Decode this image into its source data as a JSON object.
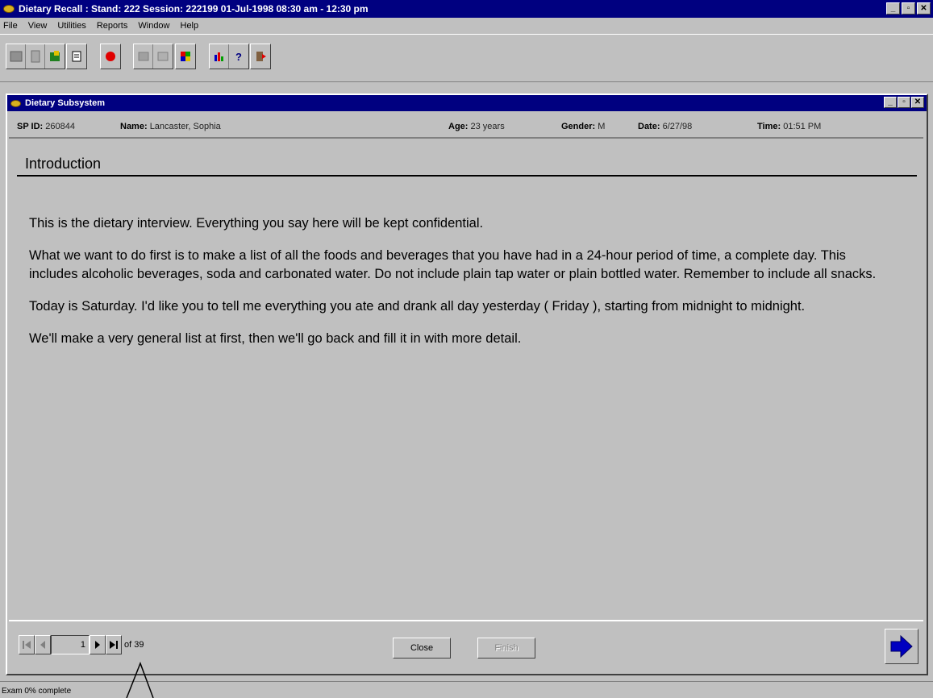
{
  "app": {
    "title": "Dietary Recall : Stand: 222 Session: 222199 01-Jul-1998 08:30 am - 12:30 pm",
    "window_controls": [
      "_",
      "▫",
      "✕"
    ]
  },
  "menu": {
    "items": [
      {
        "label": "File"
      },
      {
        "label": "View"
      },
      {
        "label": "Utilities"
      },
      {
        "label": "Reports"
      },
      {
        "label": "Window"
      },
      {
        "label": "Help"
      }
    ]
  },
  "toolbar": {
    "buttons": [
      "grid-icon",
      "clipboard-icon",
      "edit-icon",
      "notes-icon",
      "stop-icon",
      "transfer-icon",
      "calculator-icon",
      "foods-icon",
      "chart-icon",
      "help-icon",
      "exit-icon"
    ]
  },
  "child": {
    "title": "Dietary Subsystem"
  },
  "info": {
    "sp_label": "SP ID:",
    "sp_value": "260844",
    "name_label": "Name:",
    "name_value": "Lancaster, Sophia",
    "age_label": "Age:",
    "age_value": "23 years",
    "gender_label": "Gender:",
    "gender_value": "M",
    "date_label": "Date:",
    "date_value": "6/27/98",
    "time_label": "Time:",
    "time_value": "01:51 PM"
  },
  "section": {
    "title": "Introduction",
    "paragraphs": [
      "This is the dietary interview.  Everything you say here will be kept confidential.",
      "What we want to do first is to make a list of all the foods and beverages that you have had in a 24-hour period of time, a complete day.  This includes alcoholic beverages, soda and carbonated water.  Do not include plain tap water or plain bottled water.  Remember to include all snacks.",
      "Today is Saturday. I'd like you to tell me everything you ate and drank all day yesterday ( Friday ), starting from midnight to midnight.",
      "We'll make a very general list at first, then we'll go back and fill it in with more detail."
    ]
  },
  "nav": {
    "page": "1",
    "of_text": "of 39",
    "close_label": "Close",
    "finish_label": "Finish"
  },
  "status": {
    "text": "Exam 0% complete"
  }
}
